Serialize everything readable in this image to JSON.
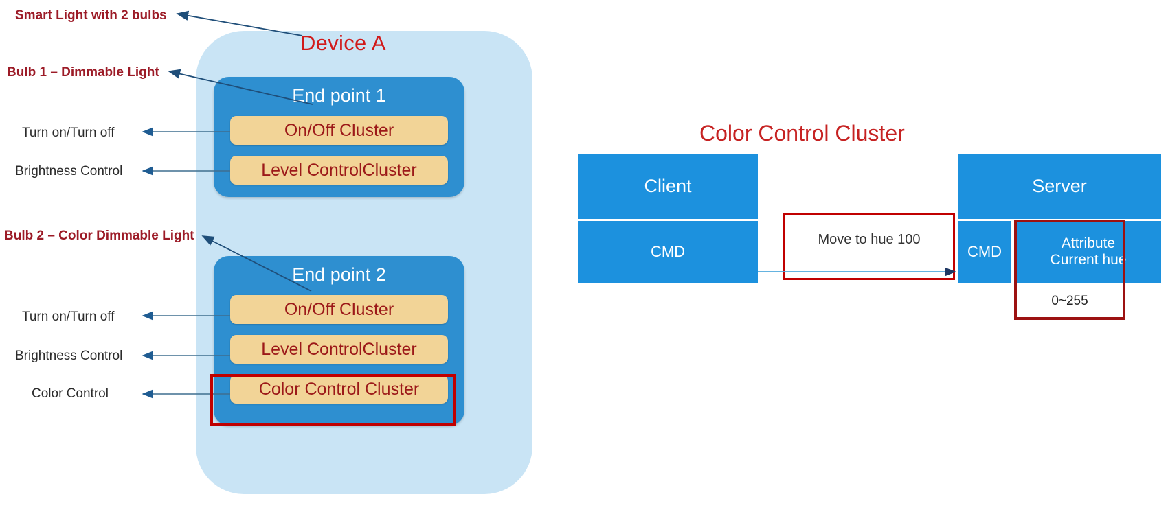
{
  "device_panel": {
    "title": "Device A",
    "background_color": "#C9E4F5",
    "endpoints": [
      {
        "title": "End point 1",
        "clusters": [
          {
            "label": "On/Off Cluster"
          },
          {
            "label": "Level ControlCluster"
          }
        ]
      },
      {
        "title": "End point 2",
        "clusters": [
          {
            "label": "On/Off Cluster"
          },
          {
            "label": "Level ControlCluster"
          },
          {
            "label": "Color Control Cluster",
            "highlighted": true
          }
        ]
      }
    ]
  },
  "annotations": {
    "device_label": "Smart Light with 2 bulbs",
    "bulb1_label": "Bulb 1 – Dimmable Light",
    "bulb2_label": "Bulb 2 – Color Dimmable Light",
    "ep1_onoff": "Turn on/Turn off",
    "ep1_level": "Brightness Control",
    "ep2_onoff": "Turn on/Turn off",
    "ep2_level": "Brightness Control",
    "ep2_color": "Color Control"
  },
  "cluster_diagram": {
    "title": "Color Control Cluster",
    "client": {
      "header": "Client",
      "cmd": "CMD"
    },
    "server": {
      "header": "Server",
      "cmd": "CMD",
      "attribute_line1": "Attribute",
      "attribute_line2": "Current hue",
      "range": "0~255"
    },
    "message": "Move to hue 100"
  },
  "colors": {
    "panel_blue": "#C9E4F5",
    "endpoint_blue": "#2E8FD0",
    "cluster_tan": "#F2D497",
    "cluster_text_red": "#9C1919",
    "title_red": "#D11A1A",
    "annotation_red": "#9C1B27",
    "highlight_red": "#C00000",
    "block_blue": "#1C91DE",
    "arrow_blue": "#1F4E79"
  }
}
